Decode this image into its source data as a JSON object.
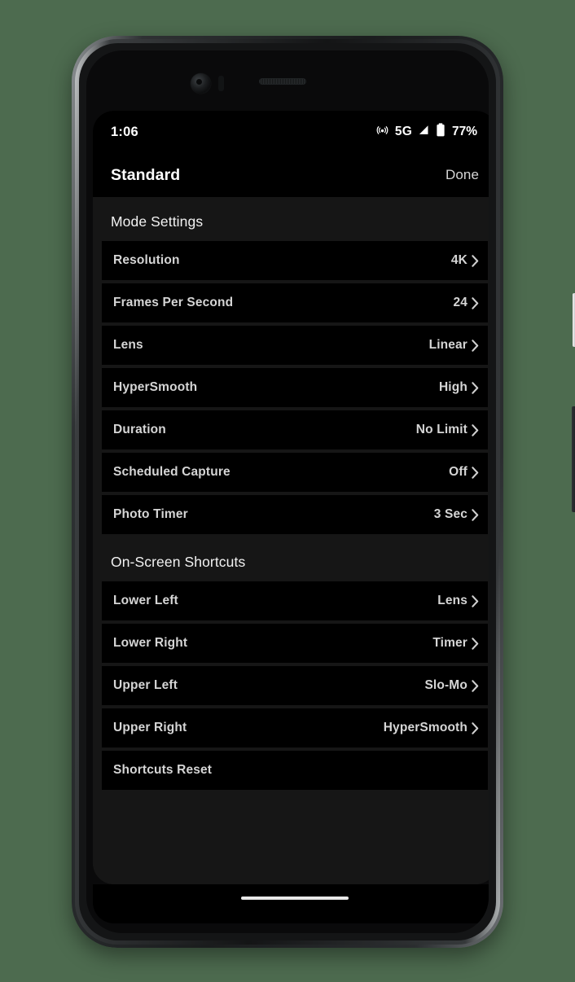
{
  "status_bar": {
    "time": "1:06",
    "hotspot_icon": "hotspot-icon",
    "network": "5G",
    "signal_icon": "signal-triangle-icon",
    "battery_icon": "battery-icon",
    "battery_percent": "77%"
  },
  "header": {
    "title": "Standard",
    "done_label": "Done"
  },
  "sections": [
    {
      "title": "Mode Settings",
      "rows": [
        {
          "label": "Resolution",
          "value": "4K",
          "chevron": true
        },
        {
          "label": "Frames Per Second",
          "value": "24",
          "chevron": true
        },
        {
          "label": "Lens",
          "value": "Linear",
          "chevron": true
        },
        {
          "label": "HyperSmooth",
          "value": "High",
          "chevron": true
        },
        {
          "label": "Duration",
          "value": "No Limit",
          "chevron": true
        },
        {
          "label": "Scheduled Capture",
          "value": "Off",
          "chevron": true
        },
        {
          "label": "Photo Timer",
          "value": "3 Sec",
          "chevron": true
        }
      ]
    },
    {
      "title": "On-Screen Shortcuts",
      "rows": [
        {
          "label": "Lower Left",
          "value": "Lens",
          "chevron": true
        },
        {
          "label": "Lower Right",
          "value": "Timer",
          "chevron": true
        },
        {
          "label": "Upper Left",
          "value": "Slo-Mo",
          "chevron": true
        },
        {
          "label": "Upper Right",
          "value": "HyperSmooth",
          "chevron": true
        },
        {
          "label": "Shortcuts Reset",
          "value": "",
          "chevron": false
        }
      ]
    }
  ],
  "nav": {
    "gesture_bar": "home-gesture-bar"
  },
  "hardware": {
    "power_button": "power-button",
    "volume_rocker": "volume-rocker",
    "front_camera": "front-camera",
    "earpiece": "earpiece-speaker"
  },
  "colors": {
    "page_background": "#4d6b4f",
    "screen_background": "#161616",
    "row_background": "#000000",
    "primary_text": "#ffffff",
    "row_text": "#d5d5d5"
  }
}
